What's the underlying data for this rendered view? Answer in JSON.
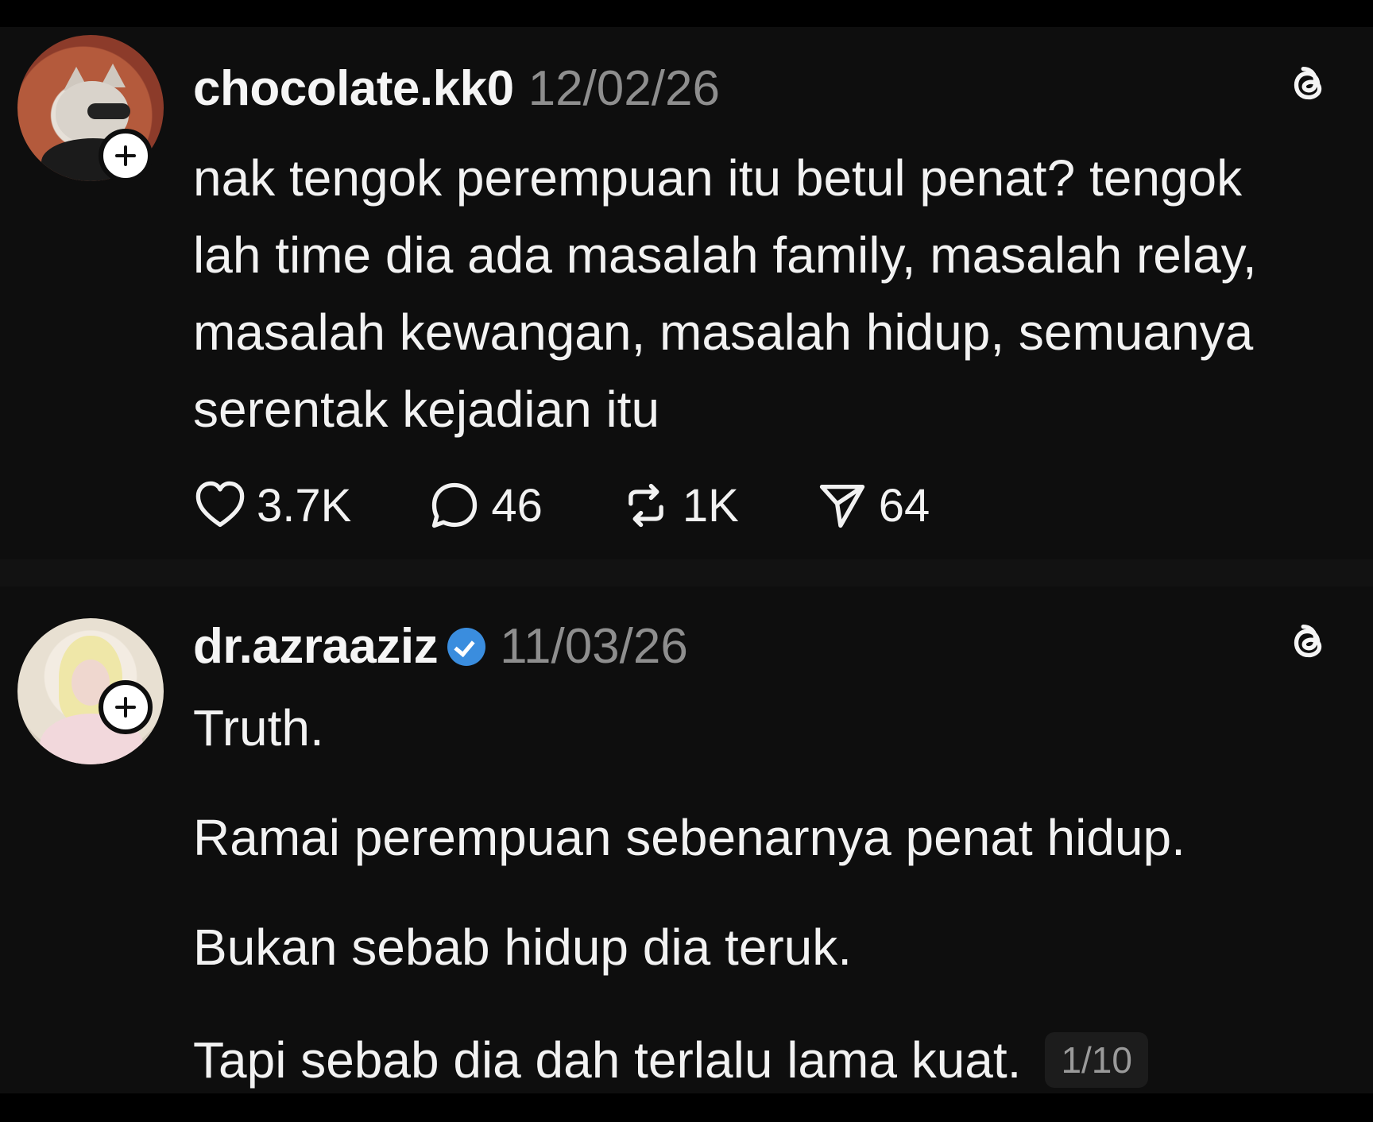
{
  "posts": [
    {
      "username": "chocolate.kk0",
      "date": "12/02/26",
      "verified": false,
      "text": "nak tengok perempuan itu betul penat? tengok lah time dia ada masalah family, masalah relay, masalah kewangan, masalah hidup, semuanya serentak kejadian itu",
      "actions": {
        "likes": "3.7K",
        "replies": "46",
        "reposts": "1K",
        "shares": "64"
      },
      "avatar_icon": "cat-avatar",
      "brand_icon": "threads-icon"
    },
    {
      "username": "dr.azraaziz",
      "date": "11/03/26",
      "verified": true,
      "paragraphs": [
        "Truth.",
        "Ramai perempuan sebenarnya penat hidup.",
        "Bukan sebab hidup dia teruk.",
        "Tapi sebab dia dah terlalu lama kuat."
      ],
      "page_indicator": "1/10",
      "avatar_icon": "profile-avatar",
      "brand_icon": "threads-icon"
    }
  ],
  "colors": {
    "background": "#0e0e0e",
    "text": "#f2f2f2",
    "muted": "#8e8e8e",
    "verified": "#3a8dde"
  }
}
